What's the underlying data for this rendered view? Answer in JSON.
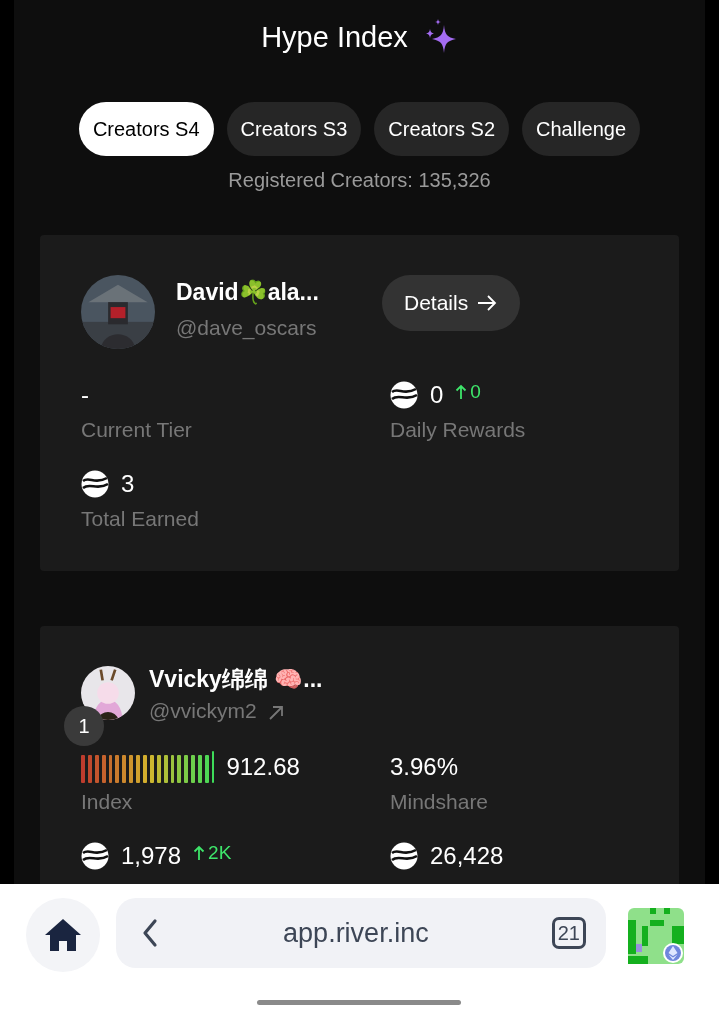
{
  "header": {
    "title": "Hype Index"
  },
  "tabs": [
    {
      "label": "Creators S4",
      "selected": true
    },
    {
      "label": "Creators S3",
      "selected": false
    },
    {
      "label": "Creators S2",
      "selected": false
    },
    {
      "label": "Challenge",
      "selected": false
    }
  ],
  "registered_creators": "Registered Creators: 135,326",
  "my_card": {
    "name": "David☘️ala...",
    "handle": "@dave_oscars",
    "details_button": "Details",
    "stats": [
      {
        "kind": "plain",
        "value": "-",
        "label": "Current Tier"
      },
      {
        "kind": "token",
        "value": "0",
        "change": "0",
        "label": "Daily Rewards"
      },
      {
        "kind": "token",
        "value": "3",
        "label": "Total Earned"
      }
    ]
  },
  "leaderboard": [
    {
      "rank": "1",
      "name": "Vvicky绵绵 🧠...",
      "handle": "@vvickym2",
      "stats": [
        {
          "kind": "meter",
          "level": 1,
          "value": "912.68",
          "label": "Index"
        },
        {
          "kind": "plain",
          "value": "3.96%",
          "label": "Mindshare"
        },
        {
          "kind": "token",
          "value": "1,978",
          "change": "2K"
        },
        {
          "kind": "token",
          "value": "26,428"
        }
      ]
    }
  ],
  "browser_bar": {
    "url": "app.river.inc",
    "tab_count": "21"
  }
}
